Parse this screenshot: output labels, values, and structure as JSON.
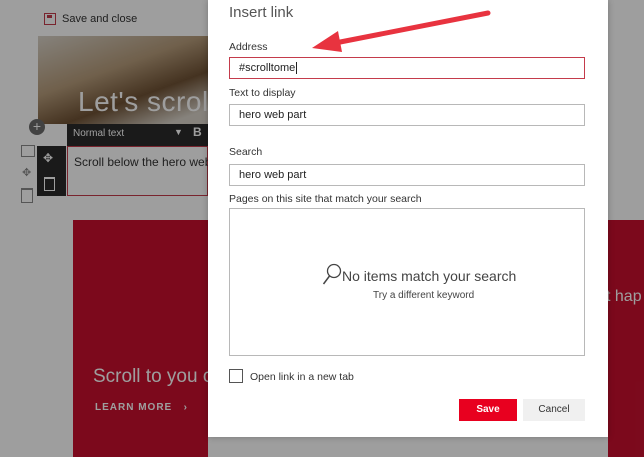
{
  "command_bar": {
    "save_and_close": "Save and close"
  },
  "page": {
    "hero_title": "Let's scroll",
    "toolbar_style": "Normal text",
    "toolbar_bold": "B",
    "textbox_text": "Scroll below the hero web",
    "red_panel_text": "Scroll to you c",
    "learn_more": "LEARN MORE",
    "right_fragment": "t hap"
  },
  "dialog": {
    "title": "Insert link",
    "address_label": "Address",
    "address_value": "#scrolltome",
    "display_label": "Text to display",
    "display_value": "hero web part",
    "search_label": "Search",
    "search_value": "hero web part",
    "pages_label": "Pages on this site that match your search",
    "no_items": "No items match your search",
    "try_different": "Try a different keyword",
    "new_tab_label": "Open link in a new tab",
    "new_tab_checked": false,
    "save_label": "Save",
    "cancel_label": "Cancel"
  },
  "annotation": {
    "arrow_color": "#e8333f"
  },
  "colors": {
    "accent_red": "#c8102e",
    "save_button": "#e8001f"
  }
}
